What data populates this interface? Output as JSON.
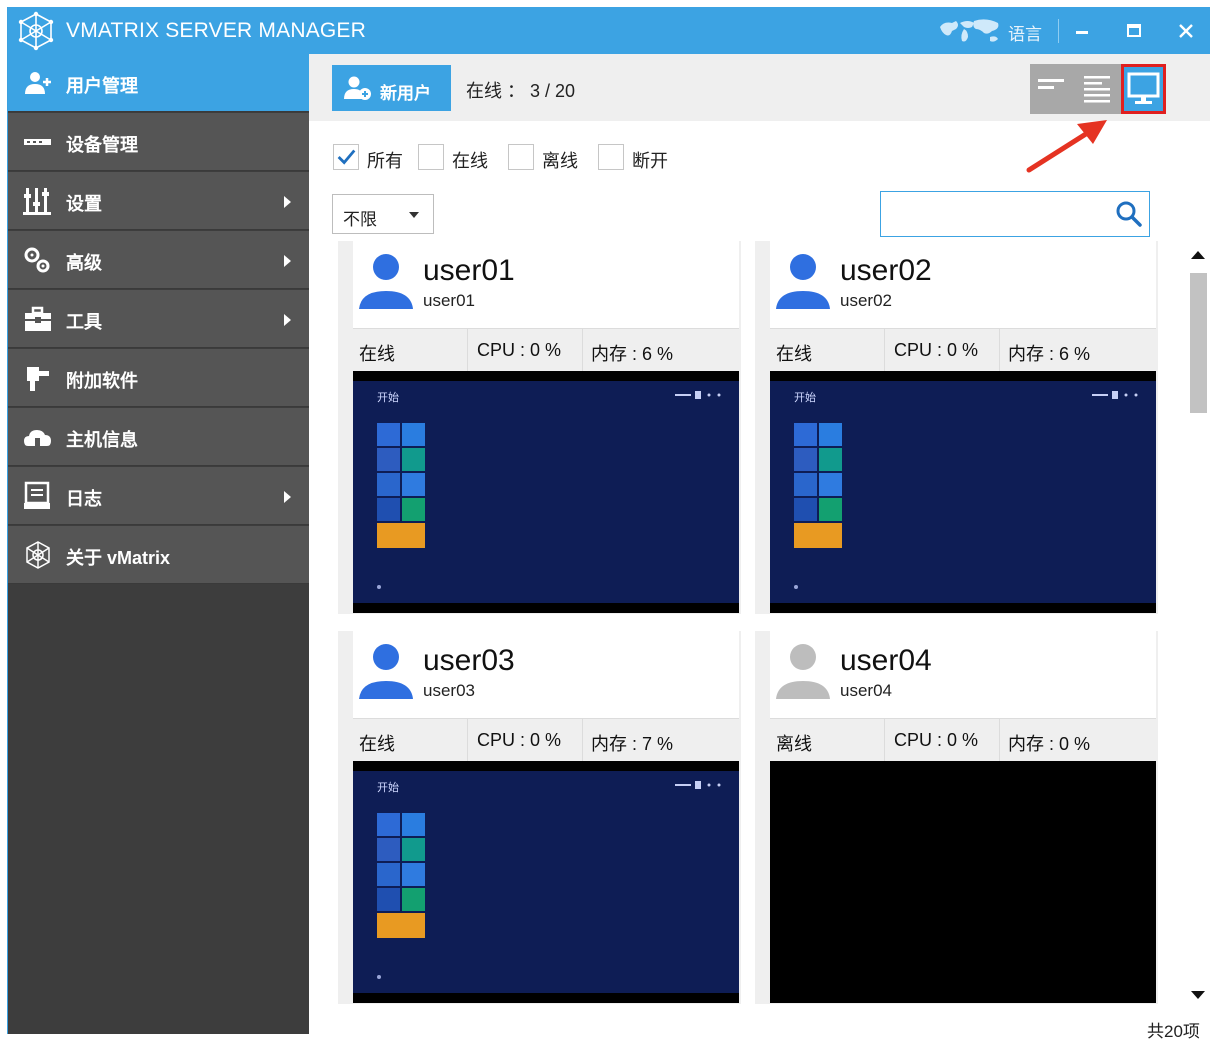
{
  "window": {
    "title": "VMATRIX SERVER MANAGER",
    "language_label": "语言",
    "accent_color": "#3ca3e3"
  },
  "sidebar": {
    "items": [
      {
        "label": "用户管理",
        "icon": "users-icon",
        "active": true,
        "has_submenu": false
      },
      {
        "label": "设备管理",
        "icon": "device-icon",
        "active": false,
        "has_submenu": false
      },
      {
        "label": "设置",
        "icon": "sliders-icon",
        "active": false,
        "has_submenu": true
      },
      {
        "label": "高级",
        "icon": "gears-icon",
        "active": false,
        "has_submenu": true
      },
      {
        "label": "工具",
        "icon": "toolbox-icon",
        "active": false,
        "has_submenu": true
      },
      {
        "label": "附加软件",
        "icon": "plugin-icon",
        "active": false,
        "has_submenu": false
      },
      {
        "label": "主机信息",
        "icon": "cloud-icon",
        "active": false,
        "has_submenu": false
      },
      {
        "label": "日志",
        "icon": "log-icon",
        "active": false,
        "has_submenu": true
      },
      {
        "label": "关于 vMatrix",
        "icon": "network-logo-icon",
        "active": false,
        "has_submenu": false
      }
    ]
  },
  "toolbar": {
    "new_user_label": "新用户",
    "online_count": "在线 ： 3 / 20",
    "view_modes": [
      "list-view",
      "detail-view",
      "screen-view"
    ],
    "active_view": "screen-view"
  },
  "filters": {
    "options": [
      {
        "label": "所有",
        "checked": true
      },
      {
        "label": "在线",
        "checked": false
      },
      {
        "label": "离线",
        "checked": false
      },
      {
        "label": "断开",
        "checked": false
      }
    ],
    "select_value": "不限",
    "search_placeholder": ""
  },
  "users": [
    {
      "name": "user01",
      "sub": "user01",
      "status": "在线",
      "cpu": "CPU : 0 %",
      "mem": "内存 : 6 %",
      "online": true,
      "desktop_start": "开始"
    },
    {
      "name": "user02",
      "sub": "user02",
      "status": "在线",
      "cpu": "CPU : 0 %",
      "mem": "内存 : 6 %",
      "online": true,
      "desktop_start": "开始"
    },
    {
      "name": "user03",
      "sub": "user03",
      "status": "在线",
      "cpu": "CPU : 0 %",
      "mem": "内存 : 7 %",
      "online": true,
      "desktop_start": "开始"
    },
    {
      "name": "user04",
      "sub": "user04",
      "status": "离线",
      "cpu": "CPU : 0 %",
      "mem": "内存 : 0 %",
      "online": false,
      "desktop_start": ""
    }
  ],
  "footer": {
    "total": "共20项"
  }
}
